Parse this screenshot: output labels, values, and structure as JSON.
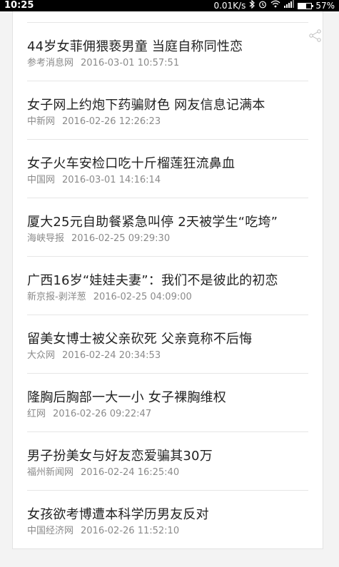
{
  "status_bar": {
    "time": "10:25",
    "speed": "0.01K/s",
    "battery_text": "57%",
    "battery_level": 0.57,
    "icons": [
      "bluetooth-icon",
      "alarm-icon",
      "wifi-icon",
      "signal-icon",
      "battery-icon"
    ]
  },
  "share_icon": "share-icon",
  "news": [
    {
      "title": "44岁女菲佣猥亵男童 当庭自称同性恋",
      "source": "参考消息网",
      "time": "2016-03-01 10:57:51"
    },
    {
      "title": "女子网上约炮下药骗财色 网友信息记满本",
      "source": "中新网",
      "time": "2016-02-26 12:26:23"
    },
    {
      "title": "女子火车安检口吃十斤榴莲狂流鼻血",
      "source": "中国网",
      "time": "2016-03-01 14:16:14"
    },
    {
      "title": "厦大25元自助餐紧急叫停 2天被学生“吃垮”",
      "source": "海峡导报",
      "time": "2016-02-25 09:29:30"
    },
    {
      "title": "广西16岁“娃娃夫妻”：我们不是彼此的初恋",
      "source": "新京报-剥洋葱",
      "time": "2016-02-25 04:09:00"
    },
    {
      "title": "留美女博士被父亲砍死 父亲竟称不后悔",
      "source": "大众网",
      "time": "2016-02-24 20:34:53"
    },
    {
      "title": "隆胸后胸部一大一小 女子裸胸维权",
      "source": "红网",
      "time": "2016-02-26 09:22:47"
    },
    {
      "title": "男子扮美女与好友恋爱骗其30万",
      "source": "福州新闻网",
      "time": "2016-02-24 16:25:40"
    },
    {
      "title": "女孩欲考博遭本科学历男友反对",
      "source": "中国经济网",
      "time": "2016-02-26 11:52:10"
    }
  ]
}
